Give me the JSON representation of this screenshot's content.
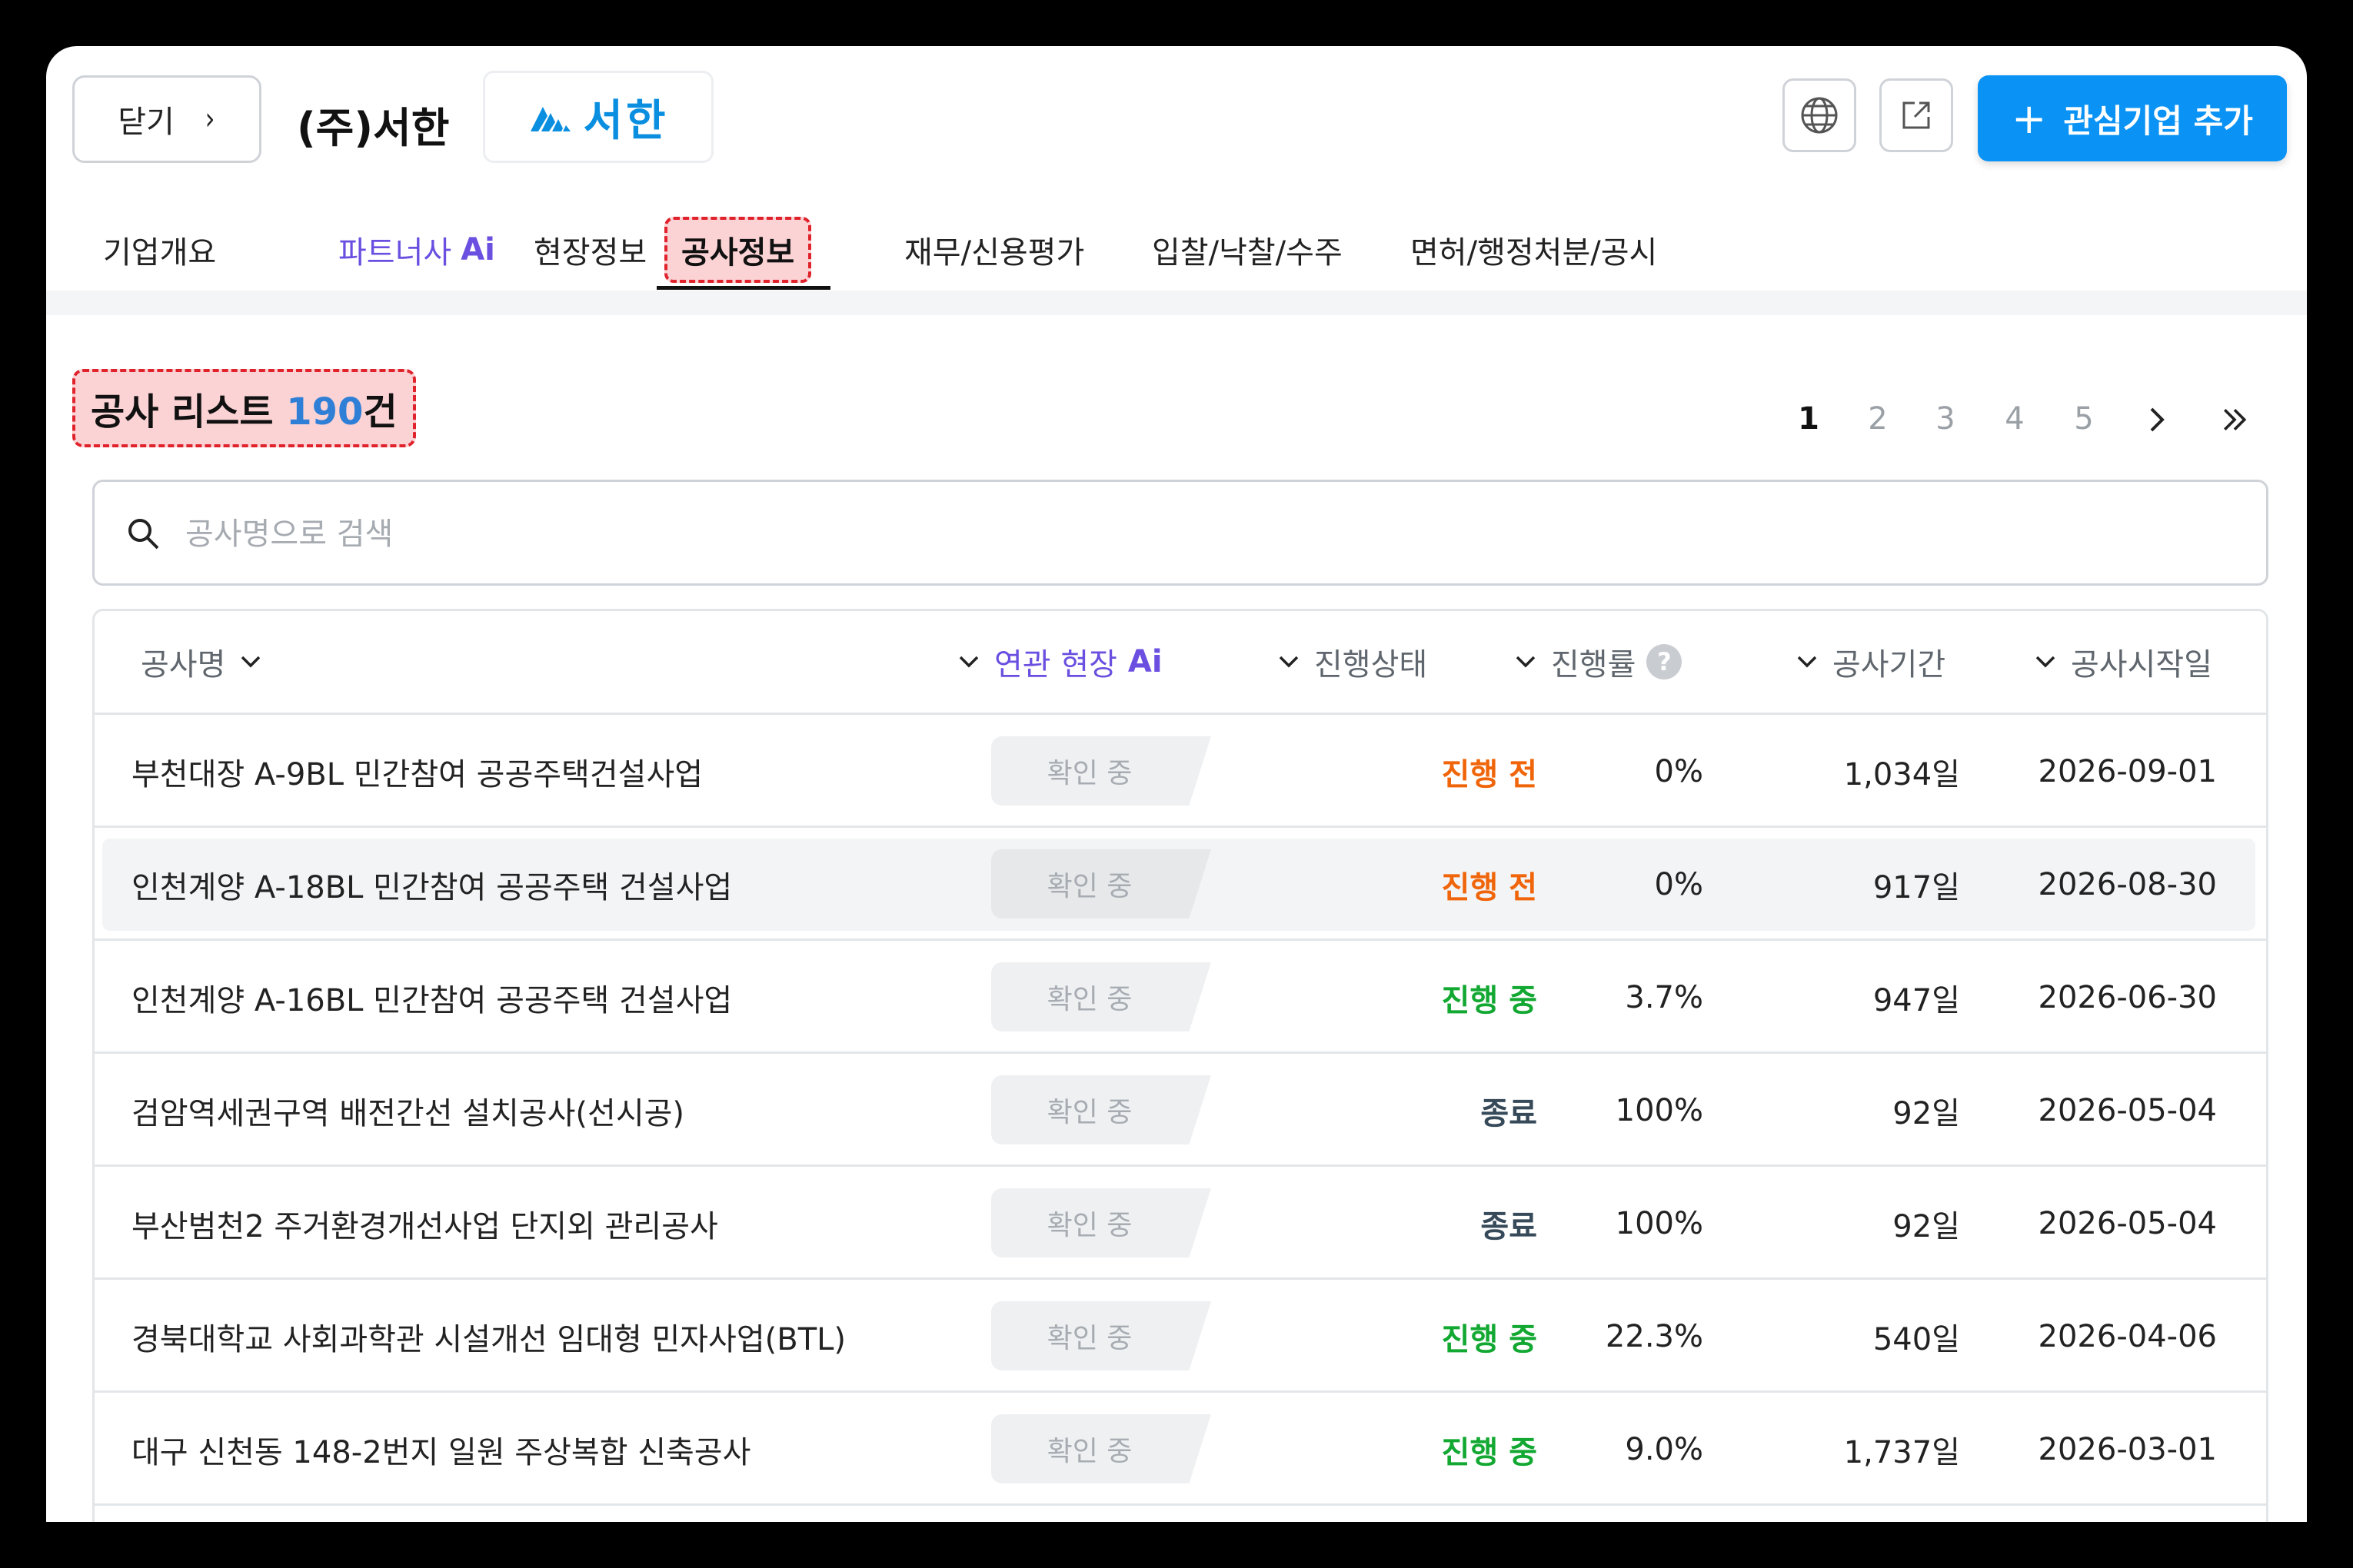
{
  "header": {
    "close_label": "닫기",
    "close_chevron": "›",
    "company_name": "(주)서한",
    "logo_text": "서한",
    "add_button_label": "관심기업 추가",
    "add_button_icon": "+"
  },
  "tabs": [
    {
      "label": "기업개요"
    },
    {
      "label": "파트너사",
      "badge": "Ai"
    },
    {
      "label": "현장정보"
    },
    {
      "label": "공사정보",
      "active": true
    },
    {
      "label": "재무/신용평가"
    },
    {
      "label": "입찰/낙찰/수주"
    },
    {
      "label": "면허/행정처분/공시"
    }
  ],
  "list": {
    "title_prefix": "공사 리스트",
    "count": "190",
    "title_suffix": "건"
  },
  "pagination": {
    "pages": [
      "1",
      "2",
      "3",
      "4",
      "5"
    ],
    "current": "1",
    "next": "›",
    "last": "»"
  },
  "search": {
    "placeholder": "공사명으로 검색",
    "value": ""
  },
  "table": {
    "columns": {
      "name": "공사명",
      "site": "연관 현장",
      "site_badge": "Ai",
      "status": "진행상태",
      "progress": "진행률",
      "progress_help": "?",
      "period": "공사기간",
      "start": "공사시작일"
    },
    "rows": [
      {
        "name": "부천대장 A-9BL 민간참여 공공주택건설사업",
        "site": "확인 중",
        "status": "진행 전",
        "status_type": "before",
        "progress": "0%",
        "period": "1,034일",
        "start": "2026-09-01"
      },
      {
        "name": "인천계양 A-18BL 민간참여 공공주택 건설사업",
        "site": "확인 중",
        "status": "진행 전",
        "status_type": "before",
        "progress": "0%",
        "period": "917일",
        "start": "2026-08-30"
      },
      {
        "name": "인천계양 A-16BL 민간참여 공공주택 건설사업",
        "site": "확인 중",
        "status": "진행 중",
        "status_type": "ongoing",
        "progress": "3.7%",
        "period": "947일",
        "start": "2026-06-30"
      },
      {
        "name": "검암역세권구역 배전간선 설치공사(선시공)",
        "site": "확인 중",
        "status": "종료",
        "status_type": "done",
        "progress": "100%",
        "period": "92일",
        "start": "2026-05-04"
      },
      {
        "name": "부산범천2 주거환경개선사업 단지외 관리공사",
        "site": "확인 중",
        "status": "종료",
        "status_type": "done",
        "progress": "100%",
        "period": "92일",
        "start": "2026-05-04"
      },
      {
        "name": "경북대학교 사회과학관 시설개선 임대형 민자사업(BTL)",
        "site": "확인 중",
        "status": "진행 중",
        "status_type": "ongoing",
        "progress": "22.3%",
        "period": "540일",
        "start": "2026-04-06"
      },
      {
        "name": "대구 신천동 148-2번지 일원 주상복합 신축공사",
        "site": "확인 중",
        "status": "진행 중",
        "status_type": "ongoing",
        "progress": "9.0%",
        "period": "1,737일",
        "start": "2026-03-01"
      }
    ]
  },
  "colors": {
    "accent_blue": "#0a93f5",
    "ai_purple": "#6a4fe0",
    "status_before": "#f0650a",
    "status_ongoing": "#12a832",
    "status_done": "#374a5a",
    "highlight_red": "#e0222c"
  },
  "icons": [
    "chevron-right-icon",
    "logo-mark-icon",
    "globe-icon",
    "external-link-icon",
    "plus-icon",
    "search-icon",
    "chevron-down-icon",
    "help-icon",
    "double-chevron-right-icon"
  ]
}
